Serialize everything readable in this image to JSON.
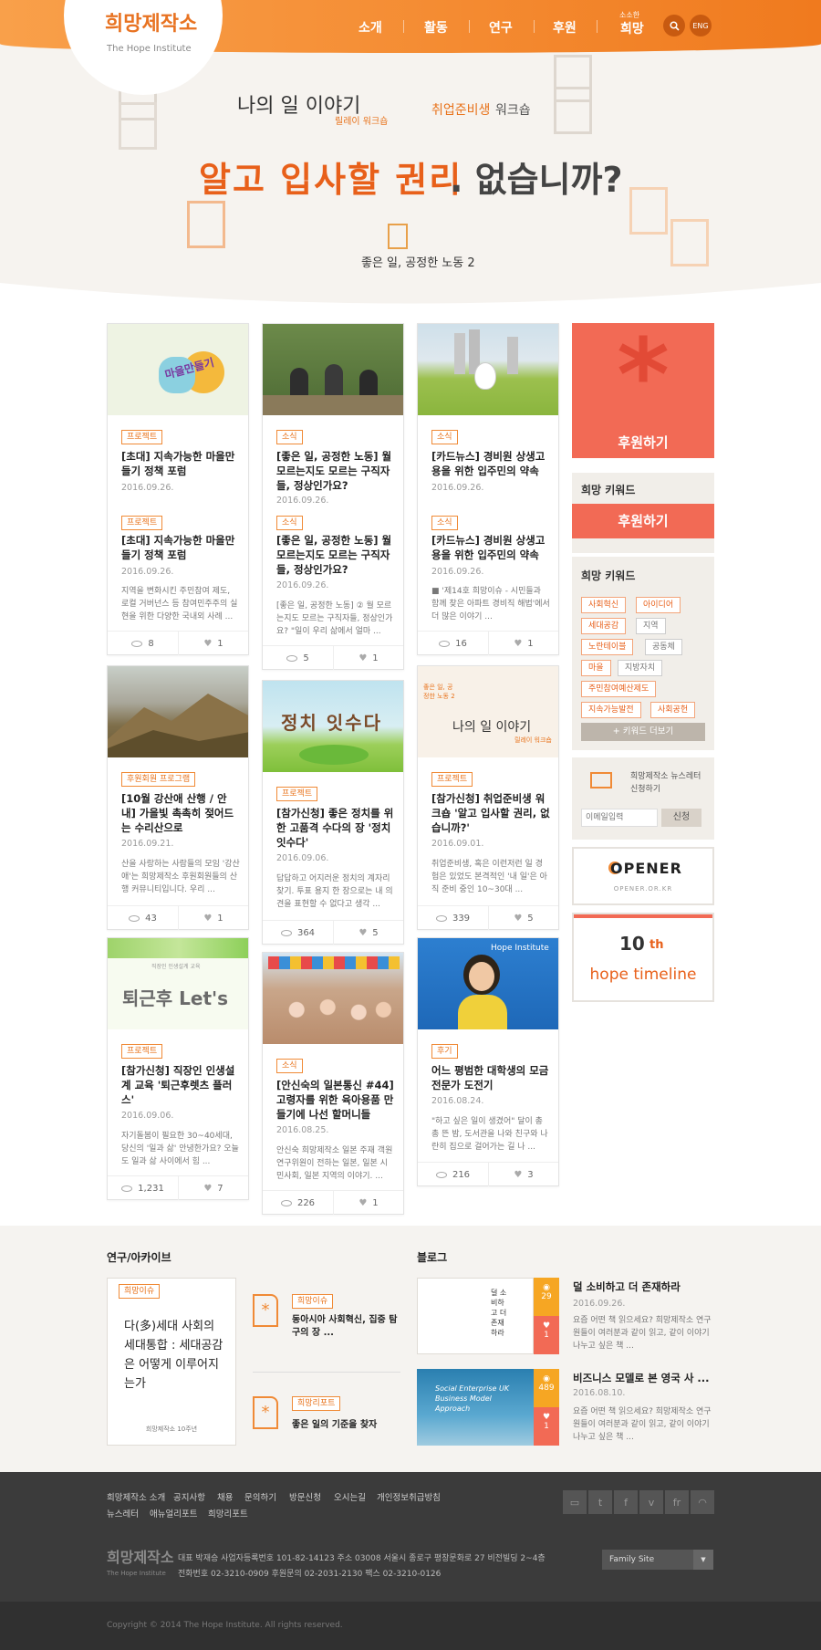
{
  "header": {
    "logo": "희망제작소",
    "logo_sub": "The Hope Institute",
    "nav": [
      "소개",
      "활동",
      "연구",
      "후원"
    ],
    "nav_hope_small": "소소한",
    "nav_hope": "희망",
    "search_icon": "search-icon",
    "eng": "ENG"
  },
  "hero": {
    "story": "나의 일 이야기",
    "story_sub": "릴레이 워크숍",
    "work_hl": "취업준비생",
    "work": "워크숍",
    "main_a": "알고 입사할 권리",
    "main_b": ". 없습니까?",
    "good": "좋은 일, 공정한 노동 2"
  },
  "cards": [
    {
      "tag": "프로젝트",
      "title": "[초대] 지속가능한 마을만들기 정책 포럼",
      "date": "2016.09.26.",
      "tag2": "프로젝트",
      "title2": "[초대] 지속가능한 마을만들기 정책 포럼",
      "date2": "2016.09.26.",
      "desc": "지역을 변화시킨 주민참여 제도, 로컬 거버넌스 등 참여민주주의 실현을 위한 다양한 국내외 사례 ...",
      "views": "8",
      "likes": "1"
    },
    {
      "tag": "소식",
      "title": "[좋은 일, 공정한 노동] 월 모르는지도 모르는 구직자들, 정상인가요?",
      "date": "2016.09.26.",
      "tag2": "소식",
      "title2": "[좋은 일, 공정한 노동] 월 모르는지도 모르는 구직자들, 정상인가요?",
      "date2": "2016.09.26.",
      "desc": "[좋은 일, 공정한 노동] ② 월 모르는지도 모르는 구직자들, 정상인가요? \"일이 우리 삶에서 얼마 ...",
      "views": "5",
      "likes": "1"
    },
    {
      "tag": "소식",
      "title": "[카드뉴스] 경비원 상생고용을 위한 입주민의 약속",
      "date": "2016.09.26.",
      "tag2": "소식",
      "title2": "[카드뉴스] 경비원 상생고용을 위한 입주민의 약속",
      "date2": "2016.09.26.",
      "desc": "■ '제14호 희망이슈 - 시민들과 함께 찾은 아파트 경비직 해법'에서 더 많은 이야기 ...",
      "views": "16",
      "likes": "1"
    },
    {
      "tag": "후원회원 프로그램",
      "title": "[10월 강산애 산행 / 안내] 가을빛 촉촉히 젖어드는 수리산으로",
      "date": "2016.09.21.",
      "desc": "산을 사랑하는 사람들의 모임 '강산애'는 희망제작소 후원회원들의 산행 커뮤니티입니다. 우리 ...",
      "views": "43",
      "likes": "1"
    },
    {
      "tag": "프로젝트",
      "title": "[참가신청] 좋은 정치를 위한 고품격 수다의 장 '정치 잇수다'",
      "date": "2016.09.06.",
      "desc": "답답하고 어지러운 정치의 계자리찾기. 투표 용지 한 장으로는 내 의견을 표현할 수 없다고 생각 ...",
      "views": "364",
      "likes": "5"
    },
    {
      "tag": "프로젝트",
      "title": "[참가신청] 취업준비생 워크숍 '알고 입사할 권리, 없습니까?'",
      "date": "2016.09.01.",
      "desc": "취업준비생, 혹은 이런저런 일 경험은 있었도 본격적인 '내 일'은 아직 준비 중인 10~30대 ...",
      "views": "339",
      "likes": "5"
    },
    {
      "tag": "프로젝트",
      "title": "[참가신청] 직장인 인생설계 교육 '퇴근후렛츠 플러스'",
      "date": "2016.09.06.",
      "desc": "자기돌봄이 필요한 30~40세대, 당신의 '일과 삶' 안녕한가요? 오늘도 일과 삶 사이에서 힘 ...",
      "views": "1,231",
      "likes": "7"
    },
    {
      "tag": "소식",
      "title": "[안신숙의 일본통신 #44] 고령자를 위한 육아용품 만들기에 나선 할머니들",
      "date": "2016.08.25.",
      "desc": "안신숙 희망제작소 일본 주재 객원연구위원이 전하는 일본, 일본 시민사회, 일본 지역의 이야기. ...",
      "views": "226",
      "likes": "1"
    },
    {
      "tag": "후기",
      "title": "어느 평범한 대학생의 모금전문가 도전기",
      "date": "2016.08.24.",
      "desc": "\"하고 싶은 일이 생겼어\" 달이 총총 뜬 밤, 도서관을 나와 친구와 나란히 집으로 걸어가는 길 나 ...",
      "views": "216",
      "likes": "3"
    }
  ],
  "thumbs": {
    "c1": "마을만들기",
    "c5": "정치 잇수다",
    "c6": "나의 일 이야기",
    "c6s": "릴레이 워크숍",
    "c6g": "좋은 일, 공정한 노동 2",
    "c7": "퇴근후 Let's",
    "c7s": "직장인 인생설계 교육",
    "c9": "Hope Institute"
  },
  "sidebar": {
    "donate": "후원하기",
    "keyword_title": "희망 키워드",
    "donate2": "후원하기",
    "keyword_title2": "희망 키워드",
    "keywords": [
      "사회혁신",
      "아이디어",
      "세대공감",
      "지역",
      "노란테이블",
      "공동체",
      "마을",
      "지방자치",
      "주민참여예산제도",
      "지속가능발전",
      "사회공헌"
    ],
    "more_keywords": "+ 키워드 더보기",
    "newsletter": "희망제작소 뉴스레터 신청하기",
    "email_placeholder": "이메일입력",
    "subscribe": "신청",
    "opener": "OPENER",
    "opener_sub": "OPENER.OR.KR",
    "timeline_10": "10",
    "timeline_th": "th",
    "timeline_text": "hope timeline"
  },
  "archive": {
    "title": "연구/아카이브",
    "feature_tag": "희망이슈",
    "feature_text": "다(多)세대 사회의 세대통합 : 세대공감은 어떻게 이루어지는가",
    "feature_foot": "희망제작소 10주년",
    "items": [
      {
        "tag": "희망이슈",
        "title": "동아시아 사회혁신, 집중 탐구의 장 ..."
      },
      {
        "tag": "희망리포트",
        "title": "좋은 일의 기준을 찾자"
      }
    ]
  },
  "blog": {
    "title": "블로그",
    "posts": [
      {
        "title": "덜 소비하고 더 존재하라",
        "date": "2016.09.26.",
        "desc": "요즘 어떤 책 읽으세요? 희망제작소 연구원들이 여러분과 같이 읽고, 같이 이야기 나누고 싶은 책 ...",
        "views": "29",
        "likes": "1",
        "thumb": "덜 소비하고 더 존재하라"
      },
      {
        "title": "비즈니스 모델로 본 영국 사 ...",
        "date": "2016.08.10.",
        "desc": "요즘 어떤 책 읽으세요? 희망제작소 연구원들이 여러분과 같이 읽고, 같이 이야기 나누고 싶은 책 ...",
        "views": "489",
        "likes": "1",
        "thumb": "Social Enterprise UK Business Model Approach"
      }
    ]
  },
  "footer": {
    "links1": [
      "희망제작소 소개",
      "공지사항",
      "채용",
      "문의하기",
      "방문신청",
      "오시는길",
      "개인정보취급방침"
    ],
    "links2": [
      "뉴스레터",
      "애뉴얼리포트",
      "희망리포트"
    ],
    "logo": "희망제작소",
    "logo_sub": "The Hope Institute",
    "info1": "대표 박재승   사업자등록번호 101-82-14123   주소 03008 서울시 종로구 평창문화로 27 비전빌딩 2~4층",
    "info2": "전화번호 02-3210-0909   후원문의 02-2031-2130   팩스 02-3210-0126",
    "family": "Family Site",
    "copyright": "Copyright © 2014 The Hope Institute. All rights reserved."
  }
}
